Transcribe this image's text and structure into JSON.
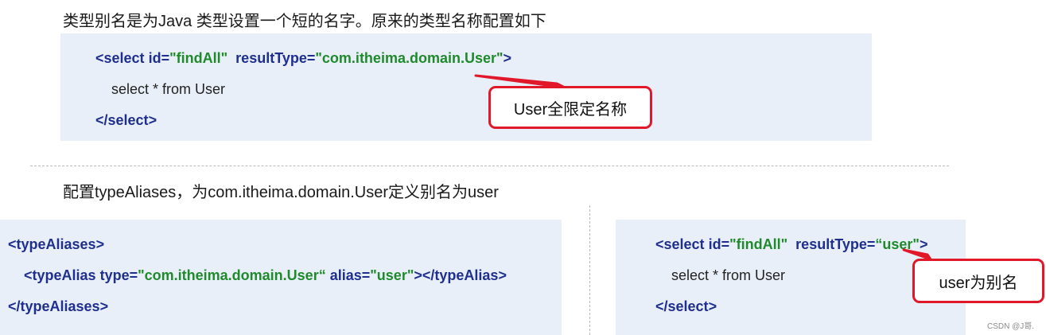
{
  "intro_text": "类型别名是为Java 类型设置一个短的名字。原来的类型名称配置如下",
  "block1": {
    "line1": {
      "open": "<",
      "tag": "select",
      "sp1": " ",
      "attr_id": "id=",
      "id_val": "\"findAll\"",
      "sp2": "  ",
      "attr_rt": "resultType=",
      "rt_val": "\"com.itheima.domain.User\"",
      "close": ">"
    },
    "line2": "select * from User",
    "line3": {
      "open": "</",
      "tag": "select",
      "close": ">"
    }
  },
  "callout1": "User全限定名称",
  "config_text": "配置typeAliases，为com.itheima.domain.User定义别名为user",
  "block2": {
    "line1": {
      "open": "<",
      "tag": "typeAliases",
      "close": ">"
    },
    "line2": {
      "open": "<",
      "tag": "typeAlias",
      "sp1": " ",
      "attr_type": "type=",
      "type_val": "\"com.itheima.domain.User“",
      "sp2": " ",
      "attr_alias": "alias=",
      "alias_val": "\"user\"",
      "close1": "></",
      "tag2": "typeAlias",
      "close2": ">"
    },
    "line3": {
      "open": "</",
      "tag": "typeAliases",
      "close": ">"
    }
  },
  "block3": {
    "line1": {
      "open": "<",
      "tag": "select",
      "sp1": " ",
      "attr_id": "id=",
      "id_val": "\"findAll\"",
      "sp2": "  ",
      "attr_rt": "resultType=",
      "rt_val": "“user\"",
      "close": ">"
    },
    "line2": "select * from User",
    "line3": {
      "open": "</",
      "tag": "select",
      "close": ">"
    }
  },
  "callout2": "user为别名",
  "watermark": "CSDN @J哥.",
  "colors": {
    "box_bg": "#e9eff8",
    "tag": "#1f2f8f",
    "string": "#1f8a2c",
    "callout_border": "#e0182a"
  }
}
